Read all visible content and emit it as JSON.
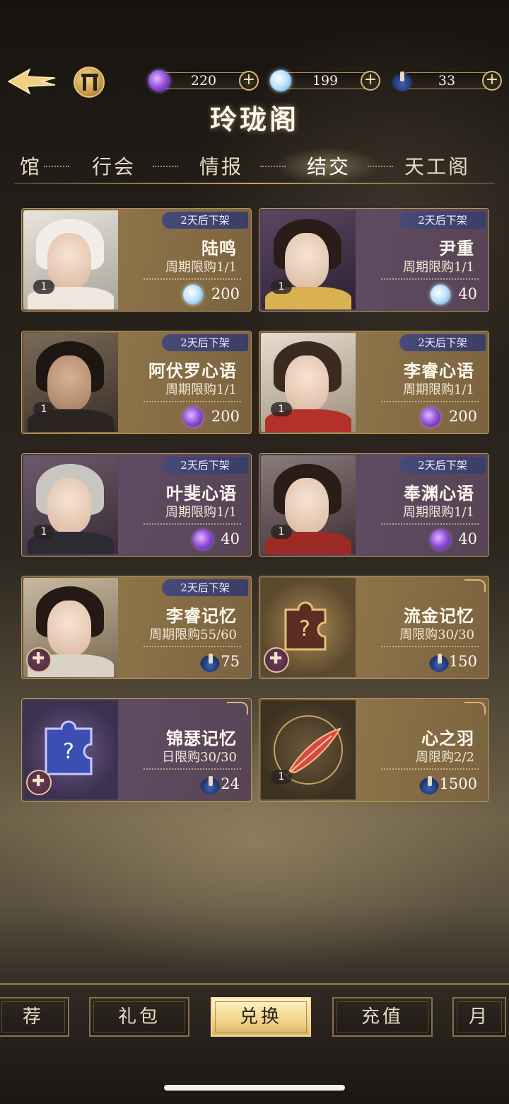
{
  "header": {
    "title": "玲珑阁",
    "resources": [
      {
        "icon": "purple-gem-icon",
        "value": "220"
      },
      {
        "icon": "water-drop-icon",
        "value": "199"
      },
      {
        "icon": "blue-vial-icon",
        "value": "33"
      }
    ],
    "plus_label": "+"
  },
  "tabs": [
    {
      "label": "馆",
      "active": false
    },
    {
      "label": "行会",
      "active": false
    },
    {
      "label": "情报",
      "active": false
    },
    {
      "label": "结交",
      "active": true
    },
    {
      "label": "天工阁",
      "active": false
    }
  ],
  "cards": [
    {
      "name": "陆鸣",
      "limit": "周期限购1/1",
      "tag": "2天后下架",
      "count": "1",
      "currency": "water-drop-icon",
      "price": "200"
    },
    {
      "name": "尹重",
      "limit": "周期限购1/1",
      "tag": "2天后下架",
      "count": "1",
      "currency": "water-drop-icon",
      "price": "40"
    },
    {
      "name": "阿伏罗心语",
      "limit": "周期限购1/1",
      "tag": "2天后下架",
      "count": "1",
      "currency": "purple-gem-icon",
      "price": "200"
    },
    {
      "name": "李睿心语",
      "limit": "周期限购1/1",
      "tag": "2天后下架",
      "count": "1",
      "currency": "purple-gem-icon",
      "price": "200"
    },
    {
      "name": "叶斐心语",
      "limit": "周期限购1/1",
      "tag": "2天后下架",
      "count": "1",
      "currency": "purple-gem-icon",
      "price": "40"
    },
    {
      "name": "奉渊心语",
      "limit": "周期限购1/1",
      "tag": "2天后下架",
      "count": "1",
      "currency": "purple-gem-icon",
      "price": "40"
    },
    {
      "name": "李睿记忆",
      "limit": "周期限购55/60",
      "tag": "2天后下架",
      "currency": "blue-vial-icon",
      "price": "75"
    },
    {
      "name": "流金记忆",
      "limit": "周限购30/30",
      "currency": "blue-vial-icon",
      "price": "150"
    },
    {
      "name": "锦瑟记忆",
      "limit": "日限购30/30",
      "currency": "blue-vial-icon",
      "price": "24"
    },
    {
      "name": "心之羽",
      "limit": "周限购2/2",
      "count": "1",
      "currency": "blue-vial-icon",
      "price": "1500"
    }
  ],
  "bottom_tabs": [
    {
      "label": "荐",
      "active": false
    },
    {
      "label": "礼包",
      "active": false
    },
    {
      "label": "兑换",
      "active": true
    },
    {
      "label": "充值",
      "active": false
    },
    {
      "label": "月",
      "active": false
    }
  ],
  "colors": {
    "accent_gold": "#c8a265",
    "tag_blue": "#464a78",
    "purple_gem": "#8b46d6",
    "active_tab": "#f0d58a"
  }
}
